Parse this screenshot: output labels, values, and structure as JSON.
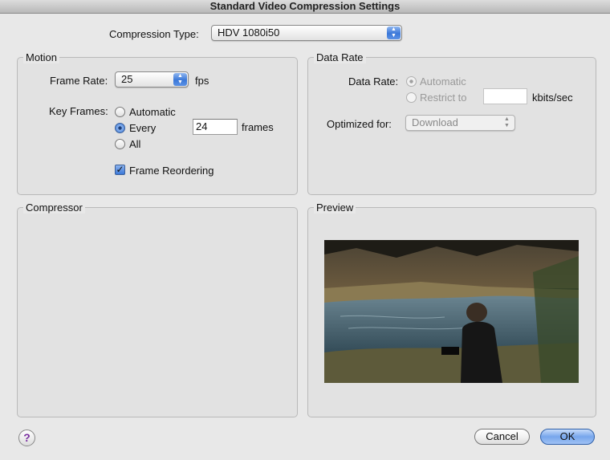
{
  "window": {
    "title": "Standard Video Compression Settings"
  },
  "compression_type": {
    "label": "Compression Type:",
    "value": "HDV 1080i50"
  },
  "motion": {
    "title": "Motion",
    "frame_rate_label": "Frame Rate:",
    "frame_rate_value": "25",
    "fps_unit": "fps",
    "key_frames_label": "Key Frames:",
    "key_frame_options": [
      "Automatic",
      "Every",
      "All"
    ],
    "key_frame_selected": "Every",
    "every_value": "24",
    "frames_unit": "frames",
    "frame_reordering_label": "Frame Reordering",
    "frame_reordering_checked": true
  },
  "data_rate": {
    "title": "Data Rate",
    "data_rate_label": "Data Rate:",
    "options": [
      "Automatic",
      "Restrict to"
    ],
    "selected": "Automatic",
    "restrict_value": "",
    "unit": "kbits/sec",
    "optimized_label": "Optimized for:",
    "optimized_value": "Download"
  },
  "compressor": {
    "title": "Compressor"
  },
  "preview": {
    "title": "Preview"
  },
  "buttons": {
    "help": "?",
    "cancel": "Cancel",
    "ok": "OK"
  },
  "colors": {
    "accent": "#3b78d8",
    "background": "#e8e8e8",
    "help_glyph": "#7a2fa0"
  }
}
